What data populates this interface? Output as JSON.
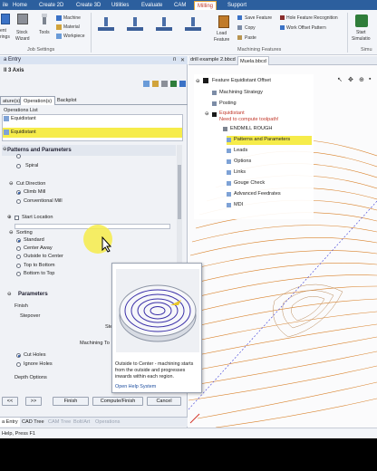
{
  "ribbon_tabs": [
    "ile",
    "Home",
    "Create 2D",
    "Create 3D",
    "Utilities",
    "Evaluate",
    "CAM",
    "Milling",
    "Support"
  ],
  "ribbon": {
    "job_setup": {
      "items": [
        "ent",
        "rings",
        "Stock",
        "Wizard",
        "Tools",
        "Machine",
        "Material",
        "Workpiece"
      ],
      "group_label": "Job Settings"
    },
    "machining": {
      "load_feature": [
        "Load",
        "Feature"
      ],
      "actions": [
        "Save Feature",
        "Copy",
        "Paste"
      ],
      "extras": [
        "Hole Feature Recognition",
        "Work Offset Pattern"
      ],
      "group_label": "Machining Features"
    },
    "sim": {
      "label": [
        "Start",
        "Simulatio"
      ],
      "group_label": "Simu"
    }
  },
  "left_panel": {
    "title": "a Entry",
    "subtitle": "ll 3 Axis",
    "tabs": [
      "ature(s)",
      "Operation(s)",
      "Backplot"
    ],
    "ops_list_label": "Operations List",
    "ops": [
      "Equidistant",
      "Equidistant"
    ],
    "patterns_title": "Patterns and Parameters",
    "pattern_items": [
      "Spiral"
    ],
    "cut_direction_label": "Cut Direction",
    "cut_direction_options": [
      "Climb Mill",
      "Conventional Mill"
    ],
    "start_location_label": "Start Location",
    "sorting_label": "Sorting",
    "sorting_options": [
      "Standard",
      "Center Away",
      "Outside to Center",
      "Top to Bottom",
      "Bottom to Top"
    ],
    "parameters_title": "Parameters",
    "finish_label": "Finish",
    "stepover_label": "Stepover",
    "ste_label": "Ste",
    "machining_to_label": "Machining To",
    "cut_holes_label": "Cut Holes",
    "ignore_holes_label": "Ignore Holes",
    "depth_options_label": "Depth Options",
    "buttons": [
      "<<",
      ">>",
      "Finish",
      "Compute/Finish",
      "Cancel"
    ],
    "bottom_tabs": [
      "a Entry",
      "CAD Tree",
      "CAM Tree",
      "Bolt/Art",
      "Operations"
    ]
  },
  "tooltip": {
    "text": "Outside to Center - machining starts from the outside and progresses inwards within each region.",
    "link": "Open Help System"
  },
  "viewport": {
    "doc_tabs": [
      "drill example 2.bbcd",
      "Muela.bbcd"
    ],
    "tree": {
      "title": "Feature Equidistant Offset",
      "items": [
        "Machining Strategy",
        "Posting",
        "Equidistant",
        "Need to compute toolpath!",
        "ENDMILL ROUGH",
        "Patterns and Parameters",
        "Leads",
        "Options",
        "Links",
        "Gouge Check",
        "Advanced Feedrates",
        "MDI"
      ]
    }
  },
  "status": {
    "text": "Help, Press F1"
  },
  "colors": {
    "ribbon_blue": "#2c5f9e",
    "accent_red": "#c2392b",
    "toolpath_orange": "#d9822b",
    "highlight_yellow": "#f6ec4a"
  }
}
